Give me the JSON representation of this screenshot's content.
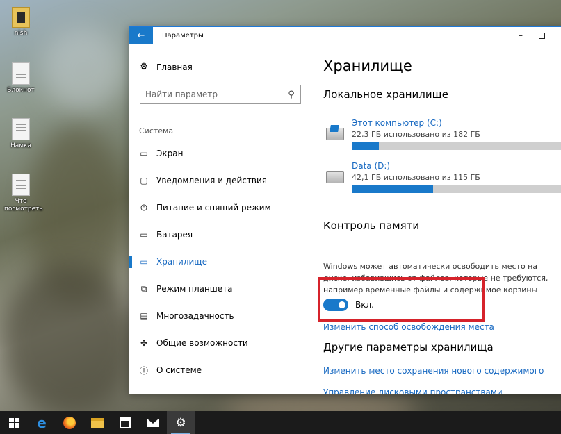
{
  "desktop": {
    "icons": [
      {
        "label": "nish"
      },
      {
        "label": "Блокнот"
      },
      {
        "label": "Намка"
      },
      {
        "label": "Что посмотреть"
      }
    ]
  },
  "window": {
    "title": "Параметры",
    "back_glyph": "←",
    "minimize_glyph": "–"
  },
  "sidebar": {
    "home_label": "Главная",
    "search_placeholder": "Найти параметр",
    "section_label": "Система",
    "items": [
      {
        "label": "Экран",
        "icon": "display-icon"
      },
      {
        "label": "Уведомления и действия",
        "icon": "notifications-icon"
      },
      {
        "label": "Питание и спящий режим",
        "icon": "power-icon"
      },
      {
        "label": "Батарея",
        "icon": "battery-icon"
      },
      {
        "label": "Хранилище",
        "icon": "storage-icon",
        "active": true
      },
      {
        "label": "Режим планшета",
        "icon": "tablet-mode-icon"
      },
      {
        "label": "Многозадачность",
        "icon": "multitasking-icon"
      },
      {
        "label": "Общие возможности",
        "icon": "shared-experiences-icon"
      },
      {
        "label": "О системе",
        "icon": "about-icon"
      }
    ]
  },
  "main": {
    "title": "Хранилище",
    "local_storage_heading": "Локальное хранилище",
    "drives": [
      {
        "name": "Этот компьютер (C:)",
        "info": "22,3 ГБ использовано из 182 ГБ",
        "used_fraction": 0.123
      },
      {
        "name": "Data (D:)",
        "info": "42,1 ГБ использовано из 115 ГБ",
        "used_fraction": 0.366
      }
    ],
    "storage_sense_heading": "Контроль памяти",
    "storage_sense_description": "Windows может автоматически освободить место на диске, избавившись от файлов, которые не требуются, например временные файлы и содержимое корзины",
    "toggle_state": "Вкл.",
    "change_link": "Изменить способ освобождения места",
    "other_heading": "Другие параметры хранилища",
    "other_links": [
      "Изменить место сохранения нового содержимого",
      "Управление дисковыми пространствами"
    ]
  },
  "colors": {
    "accent": "#1979ca",
    "highlight_box": "#d6232b"
  }
}
